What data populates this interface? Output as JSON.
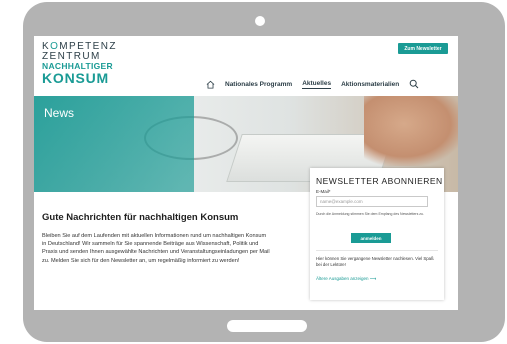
{
  "logo": {
    "line1_pre": "K",
    "line1_o": "O",
    "line1_post": "MPETENZ",
    "line2": "ZENTRUM",
    "line3": "NACHHALTIGER",
    "line4": "KONSUM"
  },
  "header": {
    "newsletter_button": "Zum Newsletter",
    "nav": [
      "Nationales Programm",
      "Aktuelles",
      "Aktionsmaterialien"
    ],
    "active_nav": "Aktuelles"
  },
  "hero": {
    "label": "News"
  },
  "main": {
    "title": "Gute Nachrichten für nachhaltigen Konsum",
    "body": "Bleiben Sie auf dem Laufenden mit aktuellen Informationen rund um nachhaltigen Konsum in Deutschland! Wir sammeln für Sie spannende Beiträge aus Wissenschaft, Politik und Praxis und senden Ihnen ausgewählte Nachrichten und Veranstaltungseinladungen per Mail zu. Melden Sie sich für den Newsletter an, um regelmäßig informiert zu werden!"
  },
  "newsletter": {
    "title": "NEWSLETTER ABONNIEREN",
    "email_label": "E-Mail*",
    "email_placeholder": "name@example.com",
    "consent": "Durch die Anmeldung stimmen Sie dem Empfang des Newsletters zu.",
    "submit": "anmelden",
    "info": "Hier können Sie vergangene Newsletter nachlesen. Viel Spaß bei der Lektüre!",
    "archive_link": "Ältere Ausgaben anzeigen ⟶"
  },
  "colors": {
    "accent": "#1a9b95",
    "device": "#b3b3b3"
  },
  "icons": [
    "home-icon",
    "search-icon"
  ]
}
